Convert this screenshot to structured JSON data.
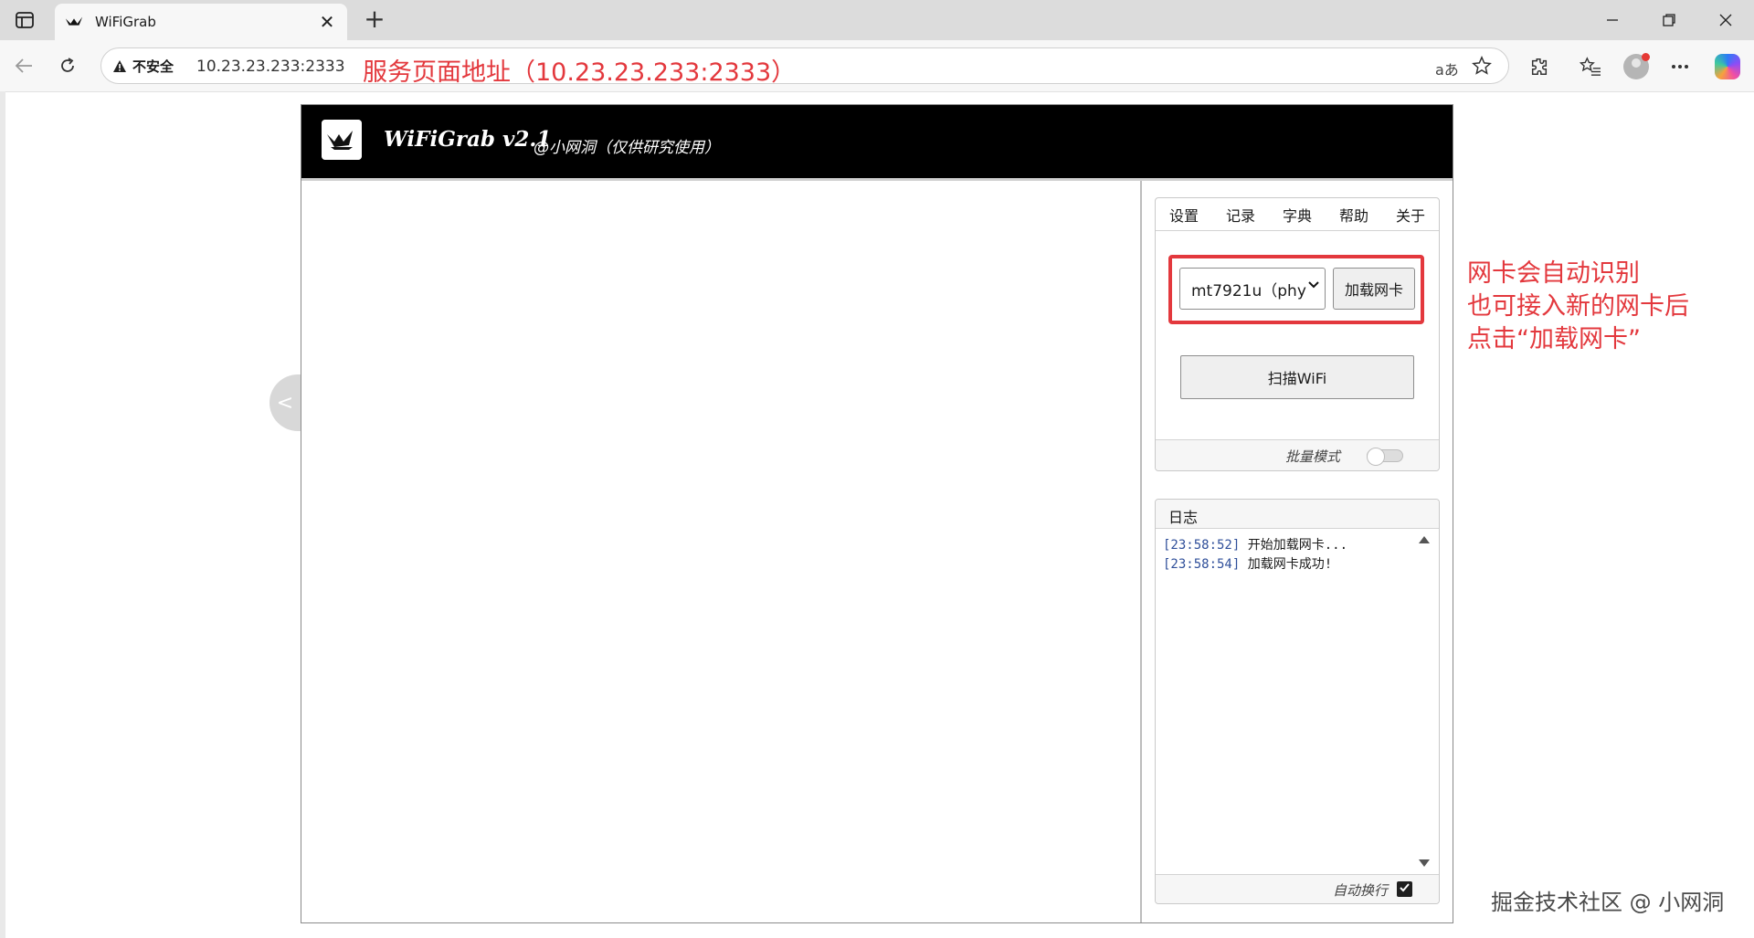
{
  "browser": {
    "tab_title": "WiFiGrab",
    "tab_close": "✕",
    "new_tab": "+",
    "security_label": "不安全",
    "url": "10.23.23.233:2333",
    "url_annotation": "服务页面地址（10.23.23.233:2333）",
    "read_aloud_glyph": "aあ"
  },
  "app": {
    "title": "WiFiGrab v2.1",
    "subtitle": "@小网洞（仅供研究使用）",
    "side_toggle": "<",
    "menu": [
      "设置",
      "记录",
      "字典",
      "帮助",
      "关于"
    ],
    "nic_select_value": "mt7921u（phy",
    "load_nic_button": "加载网卡",
    "scan_button": "扫描WiFi",
    "batch_mode_label": "批量模式",
    "batch_mode_on": false,
    "log": {
      "title": "日志",
      "lines": [
        {
          "time": "[23:58:52]",
          "text": "开始加载网卡..."
        },
        {
          "time": "[23:58:54]",
          "text": "加载网卡成功!"
        }
      ],
      "auto_wrap_label": "自动换行",
      "auto_wrap_checked": true
    }
  },
  "annotation": {
    "line1": "网卡会自动识别",
    "line2": "也可接入新的网卡后",
    "line3": "点击“加载网卡”"
  },
  "watermark": "掘金技术社区 @ 小网洞",
  "colors": {
    "annotation_red": "#e3383d",
    "header_black": "#000000",
    "log_timestamp": "#2f4f9a"
  }
}
